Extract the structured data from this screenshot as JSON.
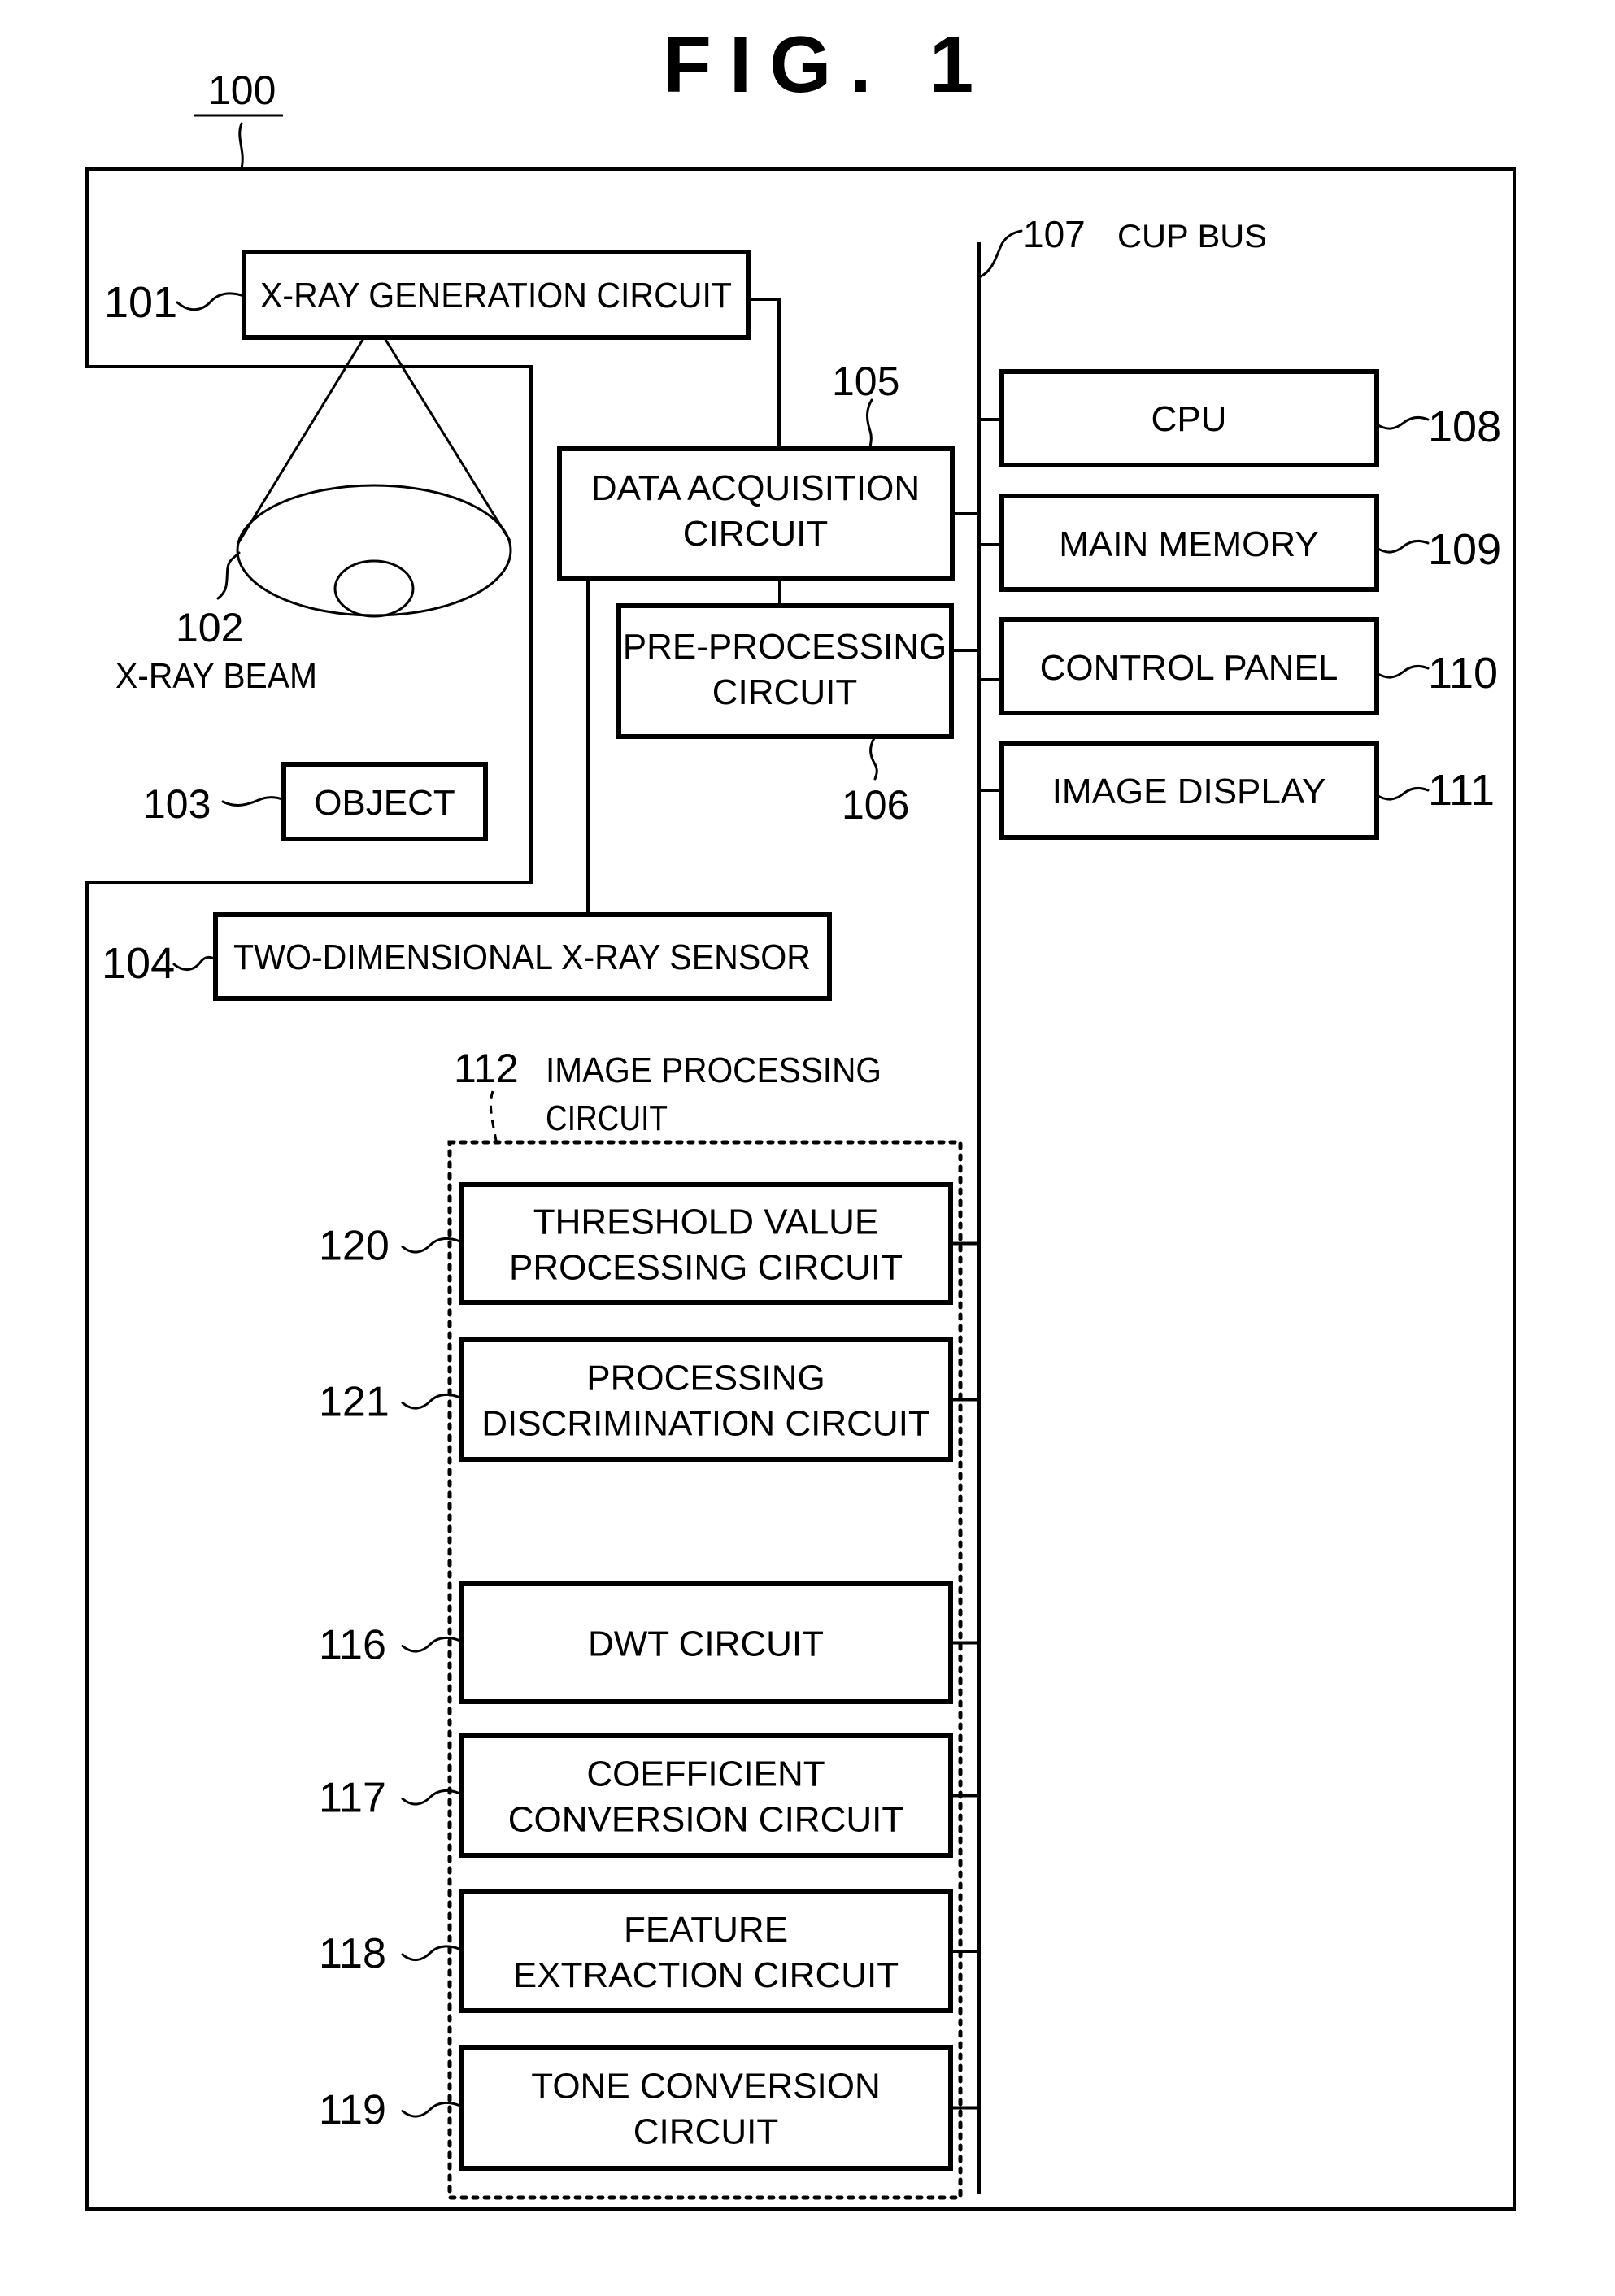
{
  "figure": {
    "title": "FIG. 1",
    "system_ref": "100"
  },
  "components": {
    "xray_generation": {
      "ref": "101",
      "lines": [
        "X-RAY GENERATION CIRCUIT"
      ]
    },
    "xray_beam": {
      "ref": "102",
      "caption": "X-RAY BEAM"
    },
    "object": {
      "ref": "103",
      "lines": [
        "OBJECT"
      ]
    },
    "sensor": {
      "ref": "104",
      "lines": [
        "TWO-DIMENSIONAL X-RAY SENSOR"
      ]
    },
    "data_acquisition": {
      "ref": "105",
      "lines": [
        "DATA ACQUISITION",
        "CIRCUIT"
      ]
    },
    "pre_processing": {
      "ref": "106",
      "lines": [
        "PRE-PROCESSING",
        "CIRCUIT"
      ]
    },
    "bus": {
      "ref": "107",
      "caption": "CUP BUS"
    },
    "cpu": {
      "ref": "108",
      "lines": [
        "CPU"
      ]
    },
    "main_memory": {
      "ref": "109",
      "lines": [
        "MAIN MEMORY"
      ]
    },
    "control_panel": {
      "ref": "110",
      "lines": [
        "CONTROL PANEL"
      ]
    },
    "image_display": {
      "ref": "111",
      "lines": [
        "IMAGE DISPLAY"
      ]
    },
    "image_processing": {
      "ref": "112",
      "caption_lines": [
        "IMAGE PROCESSING",
        "CIRCUIT"
      ],
      "blocks": [
        {
          "ref": "120",
          "lines": [
            "THRESHOLD VALUE",
            "PROCESSING CIRCUIT"
          ]
        },
        {
          "ref": "121",
          "lines": [
            "PROCESSING",
            "DISCRIMINATION CIRCUIT"
          ]
        },
        {
          "ref": "116",
          "lines": [
            "DWT CIRCUIT"
          ]
        },
        {
          "ref": "117",
          "lines": [
            "COEFFICIENT",
            "CONVERSION CIRCUIT"
          ]
        },
        {
          "ref": "118",
          "lines": [
            "FEATURE",
            "EXTRACTION CIRCUIT"
          ]
        },
        {
          "ref": "119",
          "lines": [
            "TONE CONVERSION",
            "CIRCUIT"
          ]
        }
      ]
    }
  }
}
